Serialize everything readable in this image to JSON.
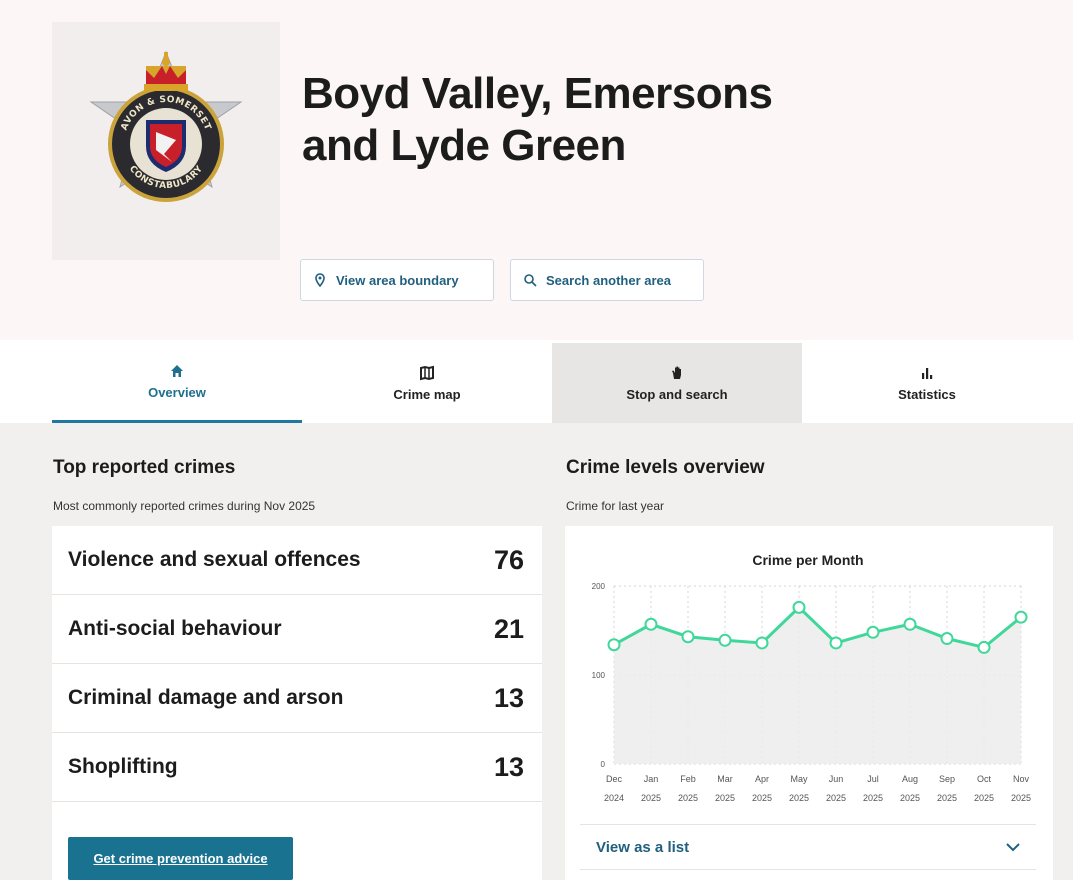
{
  "header": {
    "title": "Boyd Valley, Emersons and Lyde Green",
    "buttons": {
      "view_boundary": "View area boundary",
      "search_area": "Search another area"
    }
  },
  "logo": {
    "ring_text_top": "AVON & SOMERSET",
    "ring_text_bottom": "CONSTABULARY"
  },
  "tabs": [
    {
      "label": "Overview",
      "icon": "home-icon"
    },
    {
      "label": "Crime map",
      "icon": "map-icon"
    },
    {
      "label": "Stop and search",
      "icon": "hand-icon"
    },
    {
      "label": "Statistics",
      "icon": "bar-chart-icon"
    }
  ],
  "top_crimes": {
    "title": "Top reported crimes",
    "subtitle": "Most commonly reported crimes during Nov 2025",
    "items": [
      {
        "name": "Violence and sexual offences",
        "count": "76"
      },
      {
        "name": "Anti-social behaviour",
        "count": "21"
      },
      {
        "name": "Criminal damage and arson",
        "count": "13"
      },
      {
        "name": "Shoplifting",
        "count": "13"
      }
    ],
    "advice_button": "Get crime prevention advice"
  },
  "crime_levels": {
    "title": "Crime levels overview",
    "subtitle": "Crime for last year",
    "list_toggle": "View as a list"
  },
  "colors": {
    "accent": "#19728f",
    "line": "#3fd89a",
    "area": "#ececec"
  },
  "chart_data": {
    "type": "area",
    "title": "Crime per Month",
    "categories": [
      "Dec 2024",
      "Jan 2025",
      "Feb 2025",
      "Mar 2025",
      "Apr 2025",
      "May 2025",
      "Jun 2025",
      "Jul 2025",
      "Aug 2025",
      "Sep 2025",
      "Oct 2025",
      "Nov 2025"
    ],
    "values": [
      134,
      157,
      143,
      139,
      136,
      176,
      136,
      148,
      157,
      141,
      131,
      165
    ],
    "yticks": [
      "0",
      "100",
      "200"
    ],
    "ylim": [
      0,
      200
    ],
    "grid": true
  }
}
